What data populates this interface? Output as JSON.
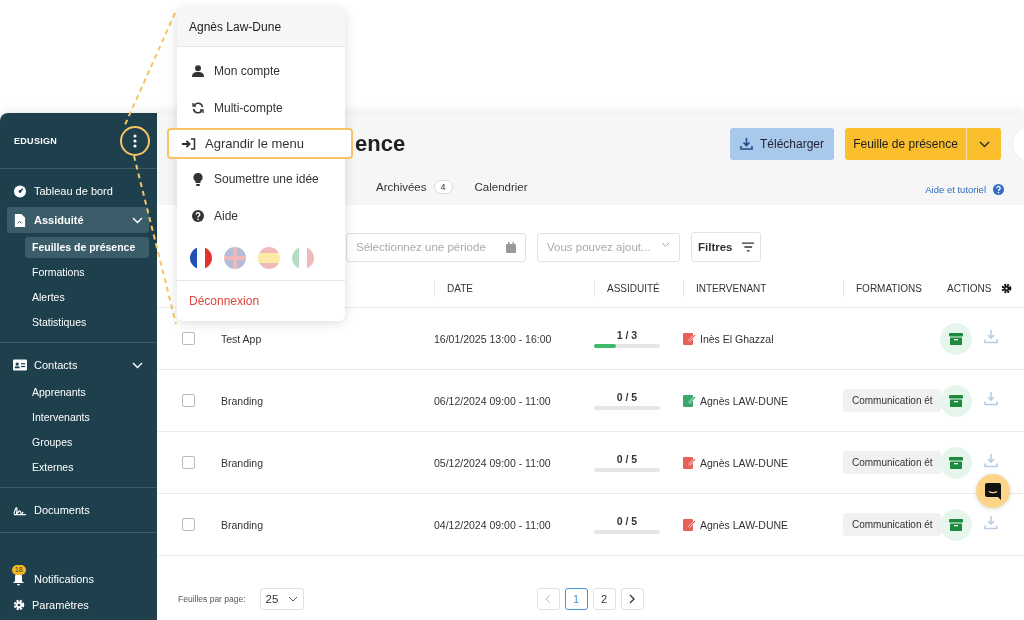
{
  "sidebar": {
    "brand": "EDUSIGN",
    "sections": [
      {
        "items": [
          {
            "label": "Tableau de bord",
            "selected": false
          },
          {
            "label": "Assiduité",
            "selected": true,
            "expanded": true,
            "children": [
              {
                "label": "Feuilles de présence",
                "selected": true
              },
              {
                "label": "Formations",
                "selected": false
              },
              {
                "label": "Alertes",
                "selected": false
              },
              {
                "label": "Statistiques",
                "selected": false
              }
            ]
          }
        ]
      },
      {
        "items": [
          {
            "label": "Contacts",
            "selected": false,
            "expanded": true,
            "children": [
              {
                "label": "Apprenants",
                "selected": false
              },
              {
                "label": "Intervenants",
                "selected": false
              },
              {
                "label": "Groupes",
                "selected": false
              },
              {
                "label": "Externes",
                "selected": false
              }
            ]
          }
        ]
      },
      {
        "items": [
          {
            "label": "Documents",
            "selected": false
          }
        ]
      }
    ],
    "footer": [
      {
        "label": "Notifications",
        "badge": "18"
      },
      {
        "label": "Paramètres"
      }
    ]
  },
  "user_menu": {
    "header": "Agnès Law-Dune",
    "items": [
      {
        "label": "Mon compte",
        "highlighted": false
      },
      {
        "label": "Multi-compte",
        "highlighted": false
      },
      {
        "label": "Agrandir le menu",
        "highlighted": true
      },
      {
        "label": "Soumettre une idée",
        "highlighted": false
      },
      {
        "label": "Aide",
        "highlighted": false
      }
    ],
    "languages": [
      {
        "kind": "fr",
        "selected": true
      },
      {
        "kind": "uk",
        "selected": false
      },
      {
        "kind": "es",
        "selected": false
      },
      {
        "kind": "it",
        "selected": false
      }
    ],
    "logout": "Déconnexion"
  },
  "header": {
    "title": "ence",
    "download_button": "Télécharger",
    "primary_button": "Feuille de présence",
    "tabs": [
      {
        "label": "Archivées",
        "count": "4",
        "selected": false
      },
      {
        "label": "Calendrier",
        "selected": false
      }
    ],
    "help_link": "Aide et tutoriel"
  },
  "filters": {
    "period": {
      "placeholder": "Sélectionnez une période"
    },
    "select": {
      "placeholder": "Vous pouvez ajout..."
    },
    "button": "Filtres"
  },
  "table": {
    "columns": [
      "DATE",
      "ASSIDUITÉ",
      "INTERVENANT",
      "FORMATIONS",
      "ACTIONS"
    ],
    "rows": [
      {
        "checked": false,
        "name": "Test App",
        "date": "16/01/2025 13:00 - 16:00",
        "attendance": "1 / 3",
        "level": 0.33,
        "speaker": {
          "name": "Inès El Ghazzal",
          "color": "#e8605a"
        }
      },
      {
        "checked": false,
        "name": "Branding",
        "date": "06/12/2024 09:00 - 11:00",
        "attendance": "0 / 5",
        "level": 0,
        "speaker": {
          "name": "Agnès LAW-DUNE",
          "color": "#3aa76d"
        },
        "formation": "Communication ét"
      },
      {
        "checked": false,
        "name": "Branding",
        "date": "05/12/2024 09:00 - 11:00",
        "attendance": "0 / 5",
        "level": 0,
        "speaker": {
          "name": "Agnès LAW-DUNE",
          "color": "#e8605a"
        },
        "formation": "Communication ét"
      },
      {
        "checked": false,
        "name": "Branding",
        "date": "04/12/2024 09:00 - 11:00",
        "attendance": "0 / 5",
        "level": 0,
        "speaker": {
          "name": "Agnès LAW-DUNE",
          "color": "#e8605a"
        },
        "formation": "Communication ét"
      }
    ]
  },
  "pagination": {
    "per_page_label": "Feuilles par page:",
    "per_page": "25",
    "pages": [
      {
        "label": "1",
        "selected": true
      },
      {
        "label": "2",
        "selected": false
      }
    ]
  }
}
